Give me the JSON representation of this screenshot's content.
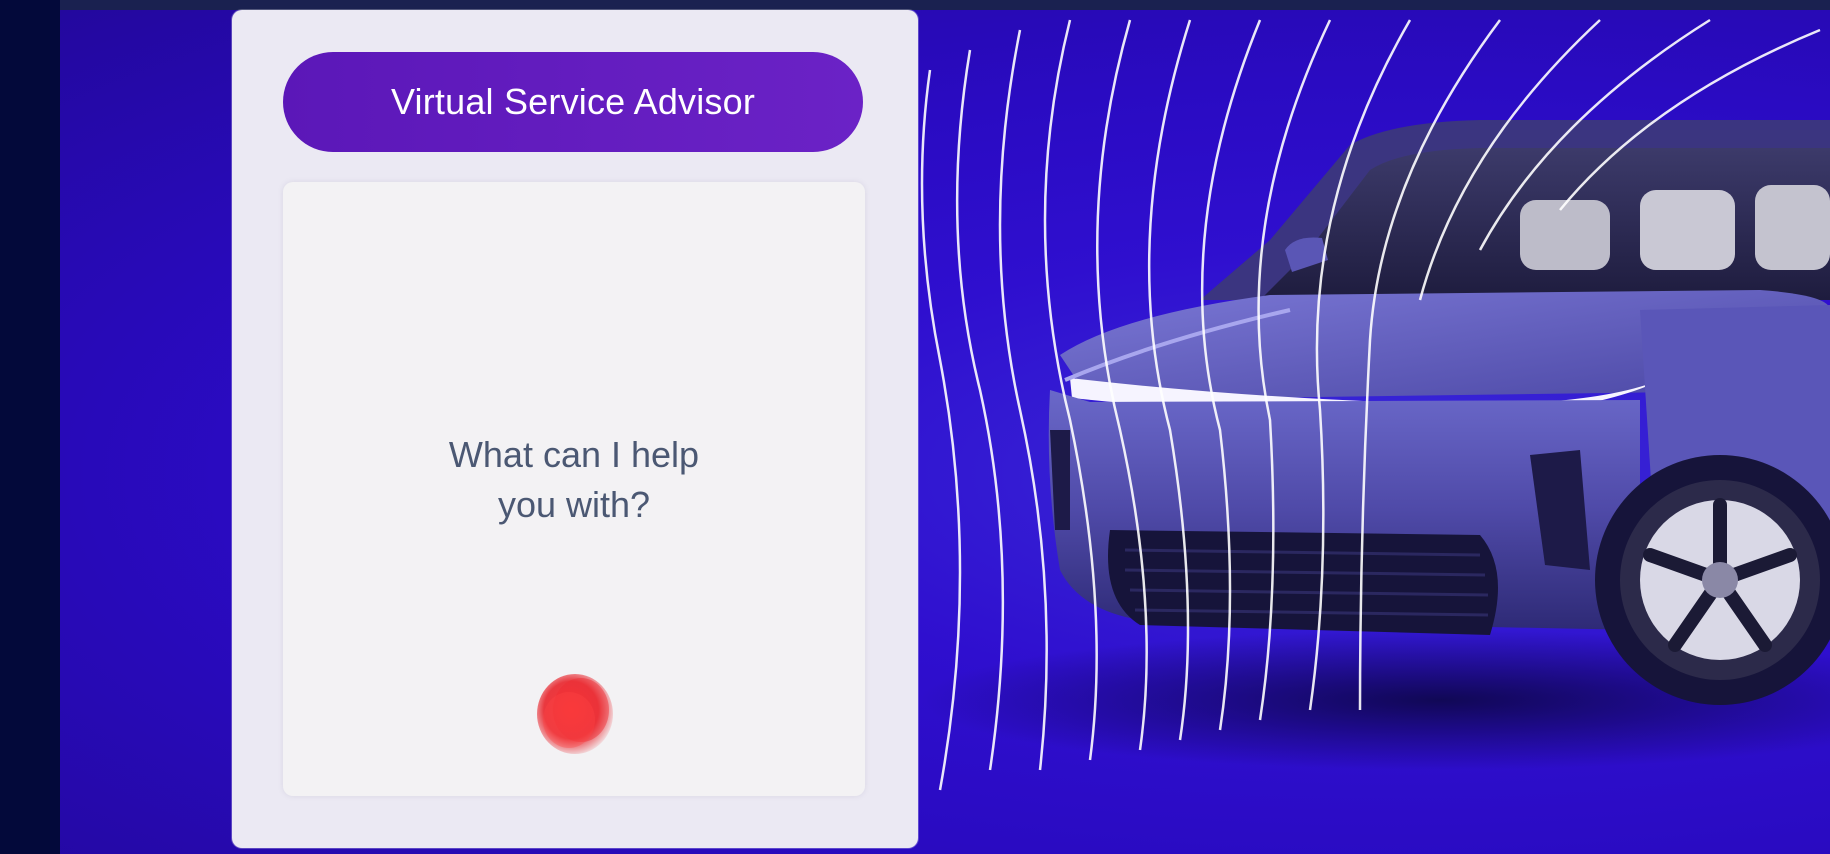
{
  "app": {
    "title": "Virtual Service Advisor"
  },
  "assistant": {
    "prompt_line1": "What can I help",
    "prompt_line2": "you with?"
  },
  "icons": {
    "voice_orb": "voice-orb-icon"
  },
  "colors": {
    "background": "#2a0bc2",
    "title_pill": "#5b17b8",
    "panel": "#ebe9f3",
    "card": "#f3f2f4",
    "prompt_text": "#4b5873",
    "orb": "#e8242b"
  }
}
